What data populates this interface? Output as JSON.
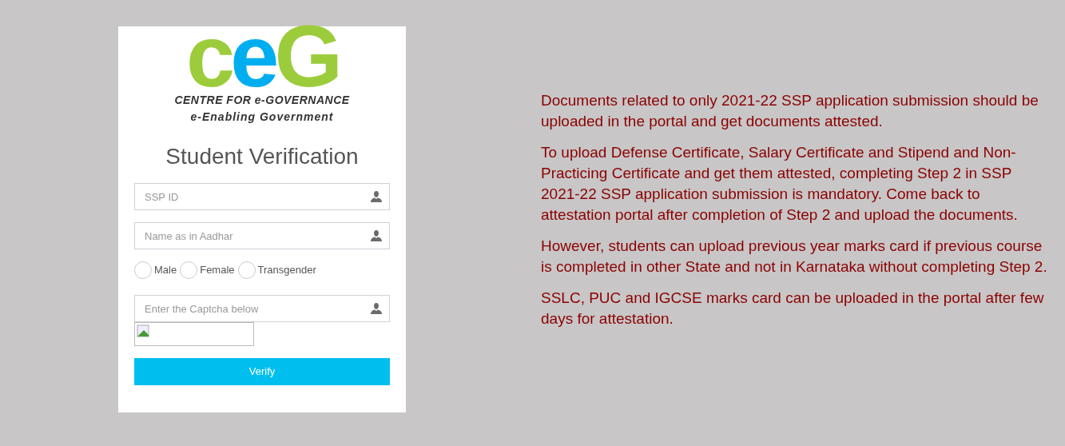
{
  "logo": {
    "letters": [
      {
        "char": "c",
        "color": "#9ccc3c"
      },
      {
        "char": "e",
        "color": "#00aeef"
      },
      {
        "char": "G",
        "color": "#9ccc3c"
      }
    ],
    "line_1": "CENTRE FOR e-GOVERNANCE",
    "line_2": "e-Enabling Government"
  },
  "form": {
    "title": "Student Verification",
    "fields": [
      {
        "placeholder": "SSP ID"
      },
      {
        "placeholder": "Name as in Aadhar"
      }
    ],
    "gender_options": [
      {
        "label": "Male",
        "selected": false
      },
      {
        "label": "Female",
        "selected": false
      },
      {
        "label": "Transgender",
        "selected": false
      }
    ],
    "captcha_field": {
      "placeholder": "Enter the Captcha below"
    },
    "verify_button": "Verify"
  },
  "notices": [
    "Documents related to only 2021-22 SSP application submission should be uploaded in the portal and get documents attested.",
    "To upload Defense Certificate, Salary Certificate and Stipend and Non-Practicing Certificate and get them attested, completing Step 2 in SSP 2021-22 SSP application submission is mandatory. Come back to attestation portal after completion of Step 2 and upload the documents.",
    "However, students can upload previous year marks card if previous course is completed in other State and not in Karnataka without completing Step 2.",
    "SSLC, PUC and IGCSE marks card can be uploaded in the portal after few days for attestation."
  ]
}
